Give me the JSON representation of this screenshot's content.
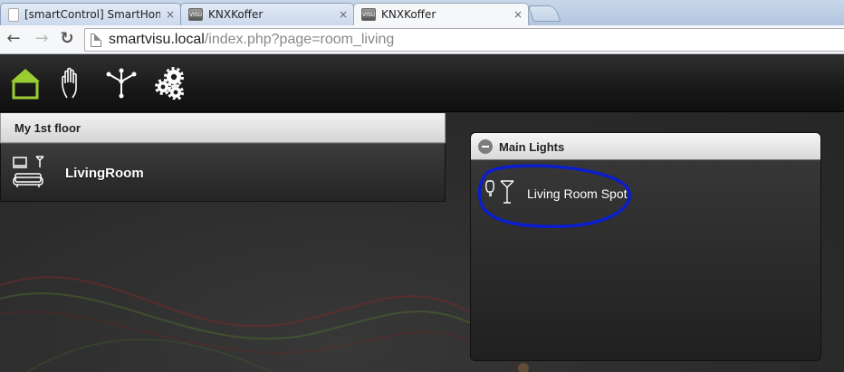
{
  "browser": {
    "tabs": [
      {
        "title": "[smartControl] SmartHom",
        "favicon": "document-icon",
        "active": false
      },
      {
        "title": "KNXKoffer",
        "favicon": "smartvisu-icon",
        "active": false
      },
      {
        "title": "KNXKoffer",
        "favicon": "smartvisu-icon",
        "active": true
      }
    ],
    "tab_close_glyph": "×",
    "favicon_text": "VISU",
    "address": {
      "host": "smartvisu.local",
      "path": "/index.php?page=room_living"
    },
    "back_glyph": "←",
    "forward_glyph": "→",
    "reload_glyph": "↻"
  },
  "app": {
    "nav_icons": [
      {
        "name": "home-icon",
        "color": "#9acd32",
        "active": true
      },
      {
        "name": "hand-icon",
        "color": "#ffffff",
        "active": false
      },
      {
        "name": "network-icon",
        "color": "#ffffff",
        "active": false
      },
      {
        "name": "gears-icon",
        "color": "#ffffff",
        "active": false
      }
    ],
    "floor": {
      "title": "My 1st floor",
      "rooms": [
        {
          "name": "LivingRoom",
          "icon": "living-room-icon"
        }
      ]
    },
    "panel": {
      "title": "Main Lights",
      "devices": [
        {
          "label": "Living Room Spot",
          "icon": "lamp-icon"
        }
      ]
    },
    "annotation_color": "#0a1ecc"
  }
}
